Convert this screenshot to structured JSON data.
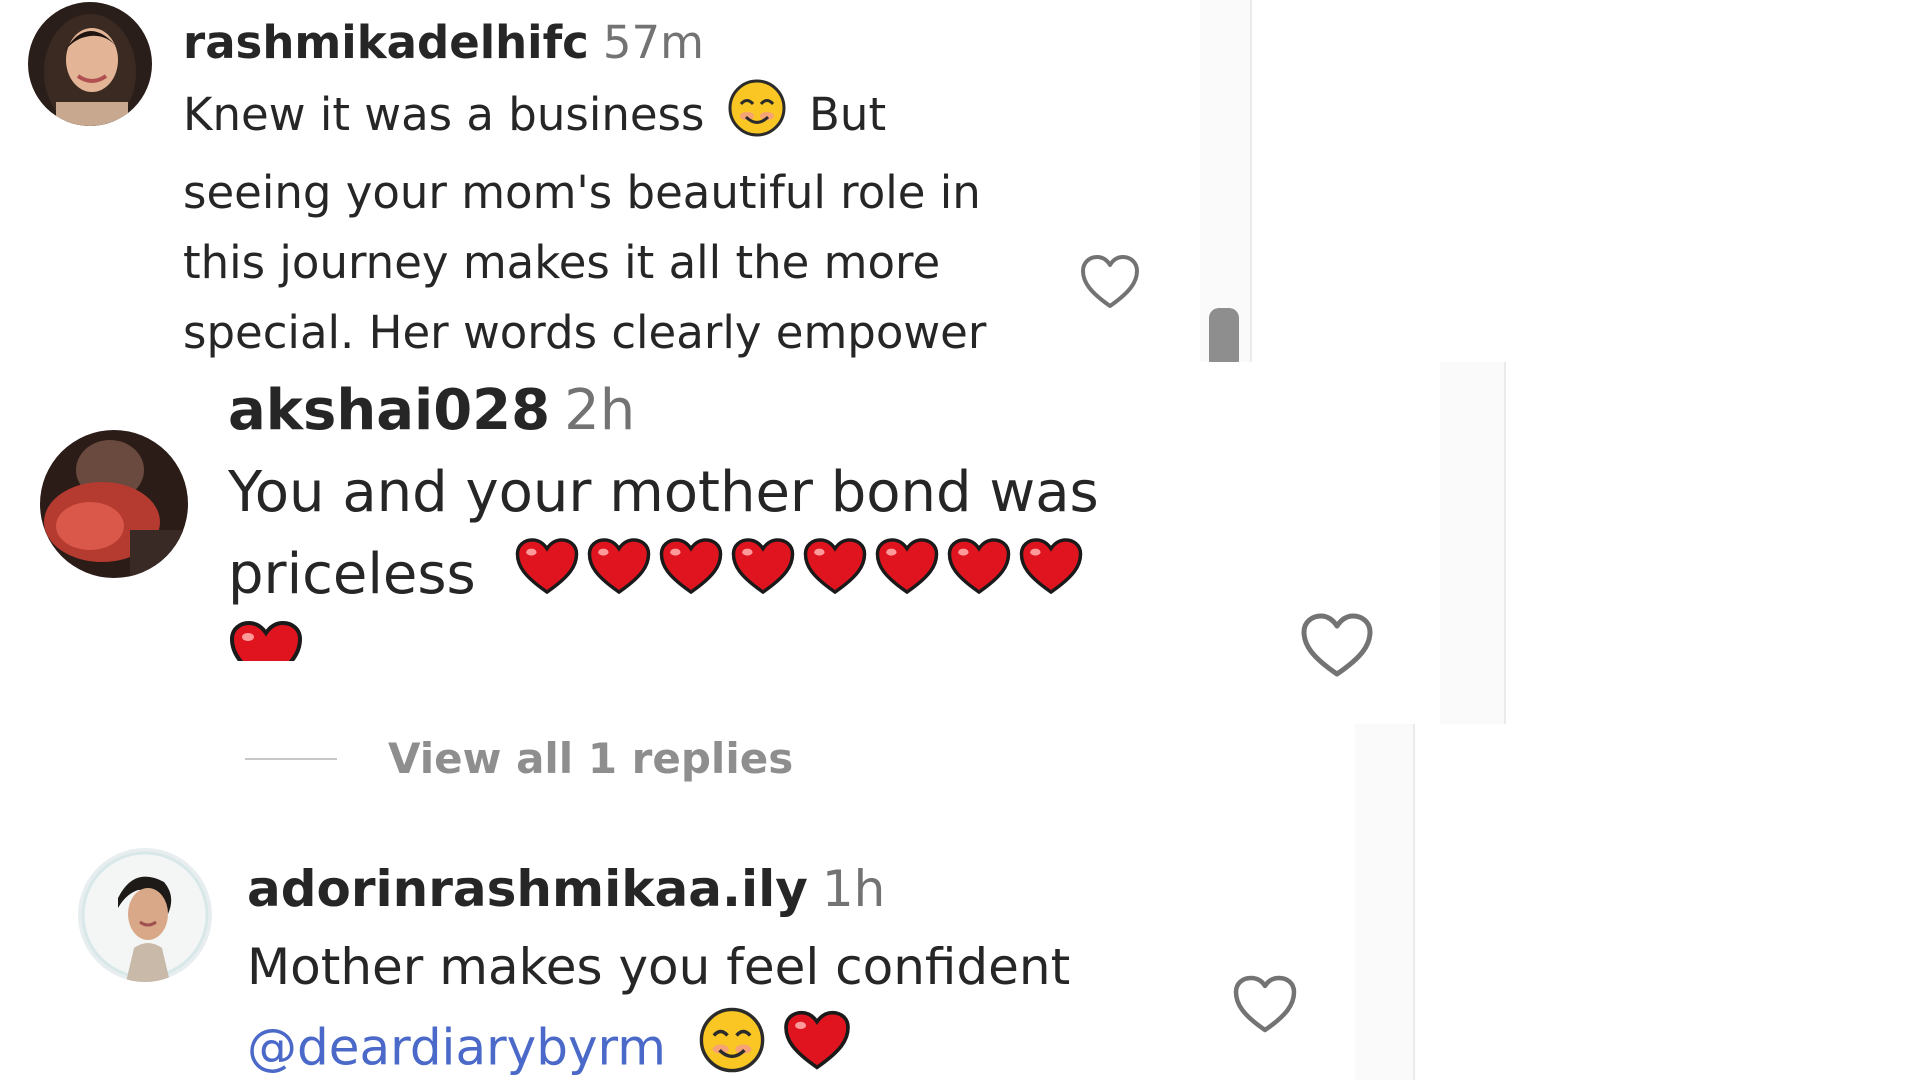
{
  "comments": [
    {
      "username": "rashmikadelhifc",
      "time": "57m",
      "lines": [
        "Knew it was a business",
        "But",
        "seeing your mom's beautiful role in",
        "this journey makes it all the more",
        "special. Her words clearly empower"
      ],
      "emoji_icons": [
        "smiling-face-icon"
      ]
    },
    {
      "username": "akshai028",
      "time": "2h",
      "lines": [
        "You and your mother bond was",
        "priceless"
      ],
      "emoji_icons": [
        "red-heart-icon"
      ],
      "heart_emoji_count": 9,
      "replies_link": "View all 1 replies"
    },
    {
      "username": "adorinrashmikaa.ily",
      "time": "1h",
      "lines": [
        "Mother makes you feel confident"
      ],
      "mention": "@deardiarybyrm",
      "emoji_icons": [
        "smiling-face-icon",
        "red-heart-icon"
      ]
    }
  ],
  "colors": {
    "text": "#262626",
    "muted": "#737373",
    "mention": "#4a69c8",
    "heart_emoji": "#e0141e",
    "replies": "#8e8e8e"
  }
}
